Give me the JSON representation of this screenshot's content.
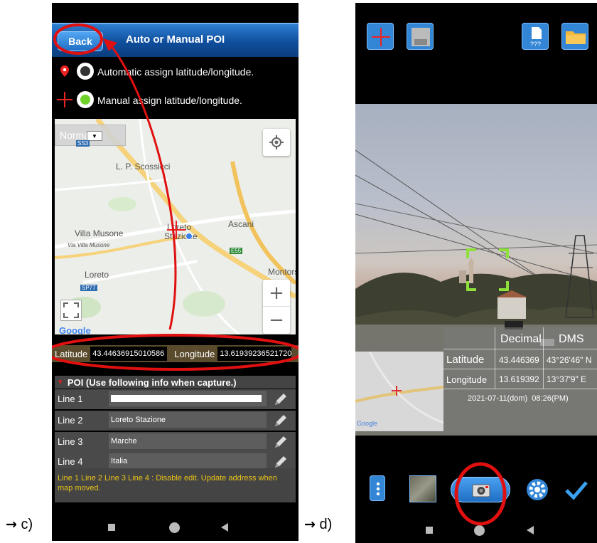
{
  "captions": {
    "c_arrow": "→",
    "c_label": "c)",
    "d_arrow": "→",
    "d_label": "d)"
  },
  "screen_c": {
    "header": {
      "back_label": "Back",
      "title": "Auto or Manual POI"
    },
    "options": [
      {
        "label": "Automatic assign latitude/longitude.",
        "selected": false,
        "icon": "map-pin-icon"
      },
      {
        "label": "Manual assign latitude/longitude.",
        "selected": true,
        "icon": "red-cross-icon"
      }
    ],
    "map": {
      "map_type": "Normal",
      "badge": "SS3",
      "places": {
        "scossicci": "L. P. Scossicci",
        "ascani": "Ascani",
        "villa_musone": "Villa Musone",
        "via_villa_musone": "Via Villa Musone",
        "loreto_stazione_1": "Loreto",
        "loreto_stazione_2": "Stazione",
        "e55": "E55",
        "montors": "Montors",
        "loreto": "Loreto",
        "sp77": "SP77"
      },
      "zoom_in": "+",
      "zoom_out": "−",
      "google": "Google"
    },
    "coords": {
      "latitude_label": "Latitude",
      "latitude_value": "43.44636915010586",
      "longitude_label": "Longitude",
      "longitude_value": "13.61939236521720"
    },
    "poi": {
      "header": "POI (Use following info when capture.)",
      "lines": [
        {
          "label": "Line 1",
          "value": ""
        },
        {
          "label": "Line 2",
          "value": "Loreto Stazione"
        },
        {
          "label": "Line 3",
          "value": "Marche"
        },
        {
          "label": "Line 4",
          "value": "Italia"
        }
      ],
      "note": "Line 1 Line 2 Line 3 Line 4 : Disable edit. Update address when map moved."
    }
  },
  "screen_d": {
    "top_icons": [
      "add-cross-icon",
      "save-disk-icon",
      "unknown-file-icon",
      "folder-icon"
    ],
    "file_badge": "???",
    "table": {
      "header_decimal": "Decimal",
      "header_dms": "DMS",
      "lat_label": "Latitude",
      "lat_decimal": "43.446369",
      "lat_dms": "43°26'46\" N",
      "lon_label": "Longitude",
      "lon_decimal": "13.619392",
      "lon_dms": "13°37'9\" E",
      "timestamp": "2021-07-11(dom)  08:26(PM)"
    },
    "inset_google": "Google",
    "bottom_icons": [
      "menu-dots-icon",
      "gallery-thumbnail-icon",
      "camera-shutter-icon",
      "settings-gear-icon",
      "confirm-check-icon"
    ]
  },
  "colors": {
    "annotation_red": "#e01010",
    "appbar_blue": "#0f4e9c",
    "note_yellow": "#e8c218",
    "viewfinder_green": "#8ee03a"
  }
}
